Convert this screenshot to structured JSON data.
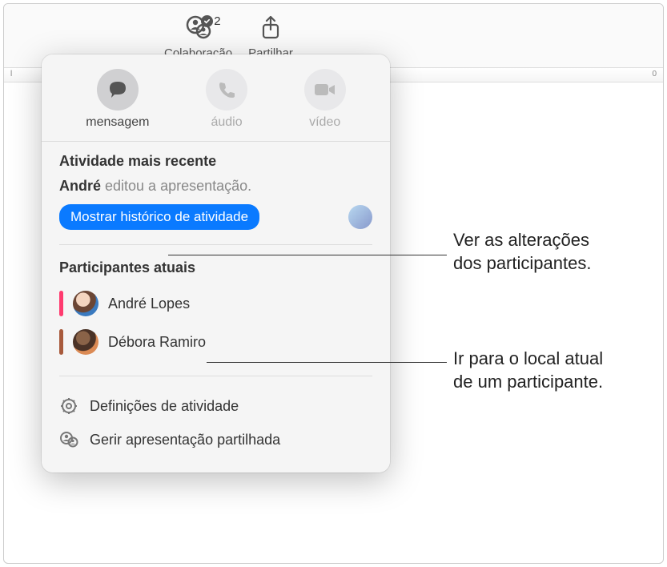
{
  "toolbar": {
    "collaboration": {
      "label": "Colaboração",
      "badge_count": "2"
    },
    "share": {
      "label": "Partilhar"
    }
  },
  "ruler": {
    "tick_left": "l",
    "tick_right": "0"
  },
  "popover": {
    "contact": {
      "message": "mensagem",
      "audio": "áudio",
      "video": "vídeo"
    },
    "activity": {
      "header": "Atividade mais recente",
      "actor": "André",
      "action": " editou a apresentação.",
      "history_button": "Mostrar histórico de atividade"
    },
    "participants": {
      "header": "Participantes atuais",
      "list": [
        {
          "name": "André Lopes"
        },
        {
          "name": "Débora Ramiro"
        }
      ]
    },
    "footer": {
      "settings": "Definições de atividade",
      "manage": "Gerir apresentação partilhada"
    }
  },
  "callouts": {
    "changes_l1": "Ver as alterações",
    "changes_l2": "dos participantes.",
    "goto_l1": "Ir para o local atual",
    "goto_l2": "de um participante."
  }
}
